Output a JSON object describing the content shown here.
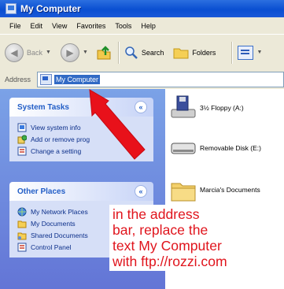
{
  "window": {
    "title": "My Computer"
  },
  "menu": [
    "File",
    "Edit",
    "View",
    "Favorites",
    "Tools",
    "Help"
  ],
  "toolbar": {
    "back": "Back",
    "search": "Search",
    "folders": "Folders"
  },
  "address": {
    "label": "Address",
    "value": "My Computer"
  },
  "system_tasks": {
    "title": "System Tasks",
    "items": [
      "View system info",
      "Add or remove prog",
      "Change a setting"
    ]
  },
  "other_places": {
    "title": "Other Places",
    "items": [
      "My Network Places",
      "My Documents",
      "Shared Documents",
      "Control Panel"
    ]
  },
  "content": {
    "items": [
      "3½ Floppy (A:)",
      "Removable Disk (E:)",
      "Marcia's Documents"
    ]
  },
  "annotation": {
    "lines": [
      "in the address",
      "bar, replace the",
      "text My Computer",
      "with ftp://rozzi.com"
    ]
  },
  "colors": {
    "titlebar": "#0a4fd1",
    "taskpane": "#6f8fe0",
    "panel_link": "#0c2f8a",
    "annotation_text": "#e0141c",
    "arrow": "#e8111a",
    "selection": "#316ac5"
  },
  "icons": {
    "title": "computer-icon",
    "up": "folder-up-icon",
    "search": "magnifier-icon",
    "folders": "folder-icon",
    "views": "views-icon",
    "arrow": "red-arrow"
  }
}
